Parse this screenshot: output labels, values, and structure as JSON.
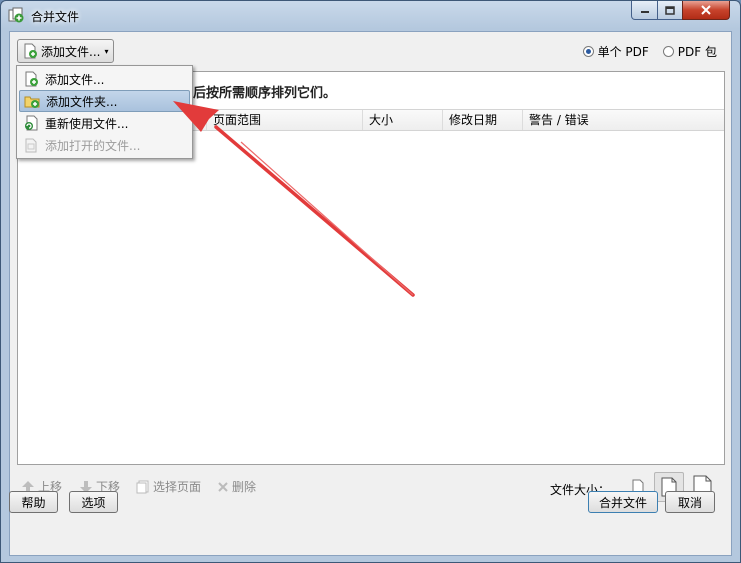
{
  "window": {
    "title": "合并文件",
    "icons": [
      "minimize-icon",
      "maximize-icon",
      "close-icon"
    ]
  },
  "toolbar": {
    "add_button_label": "添加文件...",
    "caret": "▾"
  },
  "output_mode": {
    "options": [
      "单个 PDF",
      "PDF 包"
    ],
    "selected": "单个 PDF"
  },
  "dropdown": {
    "items": [
      {
        "label": "添加文件...",
        "icon": "add-file-icon",
        "state": "normal"
      },
      {
        "label": "添加文件夹...",
        "icon": "add-folder-icon",
        "state": "highlighted"
      },
      {
        "label": "重新使用文件...",
        "icon": "reuse-files-icon",
        "state": "normal"
      },
      {
        "label": "添加打开的文件...",
        "icon": "add-open-files-icon",
        "state": "disabled"
      }
    ]
  },
  "panel": {
    "instruction": "然后按所需顺序排列它们。",
    "columns": [
      "页面范围",
      "大小",
      "修改日期",
      "警告 / 错误"
    ]
  },
  "bottom_toolbar": {
    "buttons": [
      "上移",
      "下移",
      "选择页面",
      "删除"
    ],
    "file_size_label": "文件大小："
  },
  "footer": {
    "help": "帮助",
    "options": "选项",
    "merge": "合并文件",
    "cancel": "取消"
  },
  "colors": {
    "highlight": "#a9c2dd",
    "arrow": "#e23b3b",
    "title_bar": "#b4c8de"
  }
}
